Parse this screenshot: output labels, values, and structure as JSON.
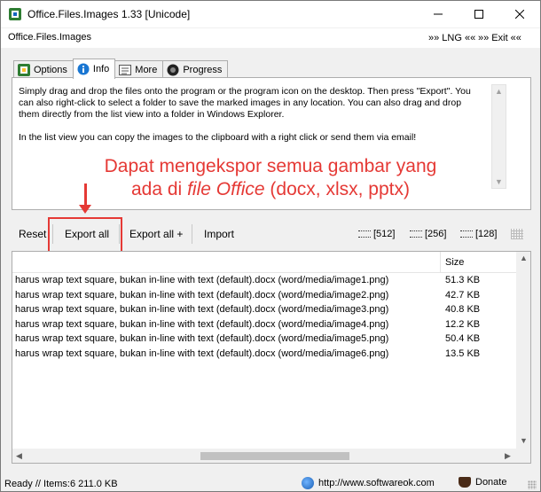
{
  "window": {
    "title": "Office.Files.Images 1.33 [Unicode]",
    "minimize_glyph": "—",
    "maximize_glyph": "☐",
    "close_glyph": "✕"
  },
  "menu": {
    "app_label": "Office.Files.Images",
    "lng_label": "»» LNG ««",
    "exit_label": "»» Exit ««"
  },
  "tabs": [
    {
      "label": "Options",
      "icon": "options-icon",
      "active": false
    },
    {
      "label": "Info",
      "icon": "info-icon",
      "active": true
    },
    {
      "label": "More",
      "icon": "more-icon",
      "active": false
    },
    {
      "label": "Progress",
      "icon": "progress-icon",
      "active": false
    }
  ],
  "info": {
    "paragraph1": "Simply drag and drop the files onto the program or the program icon on the desktop. Then press \"Export\". You can also right-click to select a folder to save the marked images in any location. You can also drag and drop them directly from the list view into a folder in Windows Explorer.",
    "paragraph2": "In the list view you can copy the images to the clipboard with a right click or send them via email!"
  },
  "annotation": {
    "line1": "Dapat mengekspor semua gambar yang",
    "line2_prefix": "ada di ",
    "line2_italic": "file Office",
    "line2_suffix": " (docx, xlsx, pptx)",
    "color": "#e53935"
  },
  "toolbar": {
    "reset": "Reset",
    "export_all": "Export all",
    "export_all_plus": "Export all +",
    "import": "Import",
    "size_512": "[512]",
    "size_256": "[256]",
    "size_128": "[128]"
  },
  "list": {
    "size_header": "Size",
    "rows": [
      {
        "name": "harus wrap text square, bukan in-line with text (default).docx (word/media/image1.png)",
        "size": "51.3 KB"
      },
      {
        "name": "harus wrap text square, bukan in-line with text (default).docx (word/media/image2.png)",
        "size": "42.7 KB"
      },
      {
        "name": "harus wrap text square, bukan in-line with text (default).docx (word/media/image3.png)",
        "size": "40.8 KB"
      },
      {
        "name": "harus wrap text square, bukan in-line with text (default).docx (word/media/image4.png)",
        "size": "12.2 KB"
      },
      {
        "name": "harus wrap text square, bukan in-line with text (default).docx (word/media/image5.png)",
        "size": "50.4 KB"
      },
      {
        "name": "harus wrap text square, bukan in-line with text (default).docx (word/media/image6.png)",
        "size": "13.5 KB"
      }
    ]
  },
  "status": {
    "text": "Ready // Items:6 211.0 KB",
    "url": "http://www.softwareok.com",
    "donate": "Donate"
  }
}
